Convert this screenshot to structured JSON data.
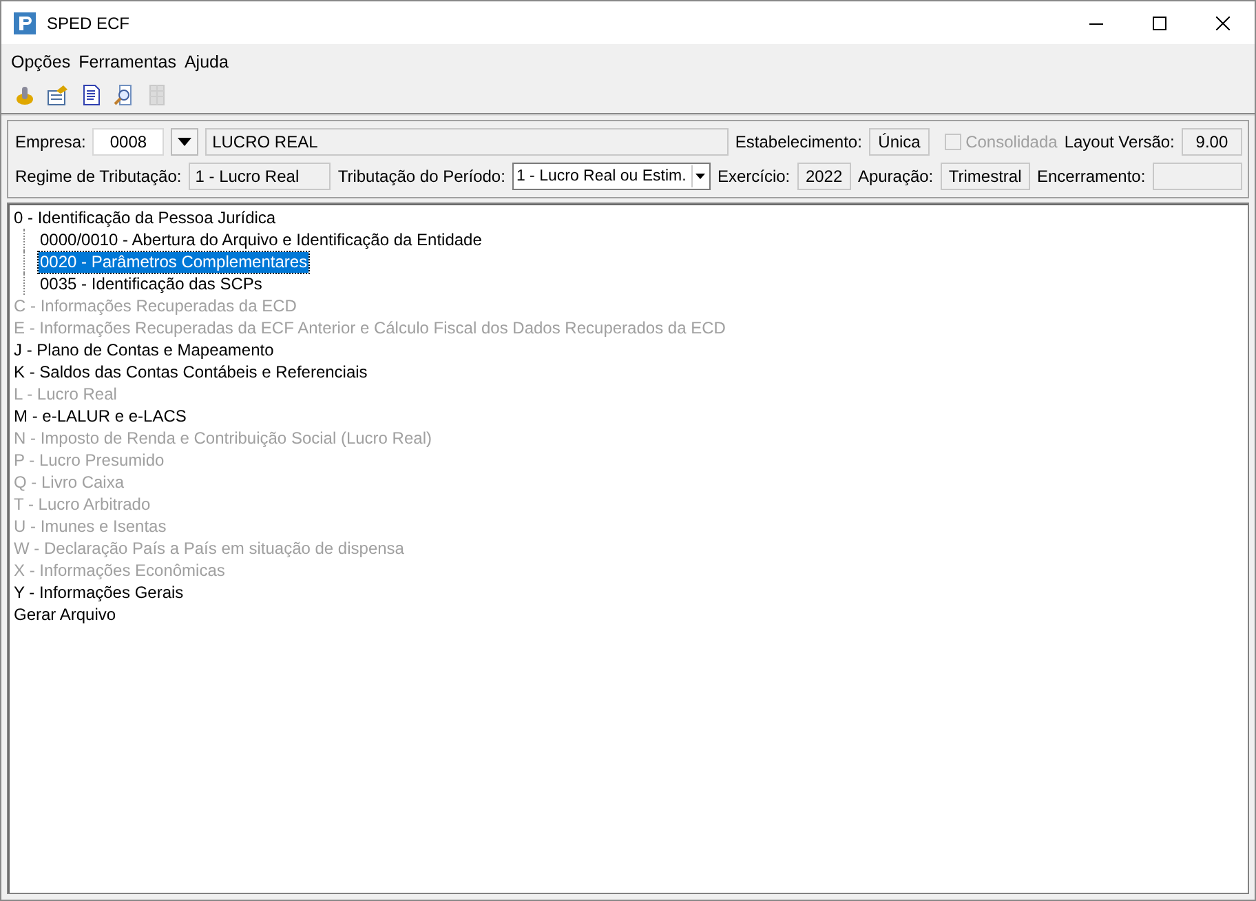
{
  "window": {
    "title": "SPED ECF"
  },
  "menu": [
    {
      "label": "Opções"
    },
    {
      "label": "Ferramentas"
    },
    {
      "label": "Ajuda"
    }
  ],
  "toolbar": [
    {
      "kind": "wizard",
      "disabled": false
    },
    {
      "kind": "open",
      "disabled": false
    },
    {
      "kind": "document",
      "disabled": false
    },
    {
      "kind": "preview",
      "disabled": false
    },
    {
      "kind": "grid",
      "disabled": true
    }
  ],
  "header": {
    "row_1": [
      {
        "kind": "label",
        "text": "Empresa:"
      },
      {
        "kind": "input",
        "value": "0008"
      },
      {
        "kind": "dropbutton"
      },
      {
        "kind": "readonly",
        "value": "LUCRO REAL"
      },
      {
        "kind": "label",
        "text": "Estabelecimento:"
      },
      {
        "kind": "readonly",
        "value": "Única"
      },
      {
        "kind": "checkbox",
        "text": "Consolidada",
        "checked": false,
        "disabled": true
      },
      {
        "kind": "label",
        "text": "Layout Versão:"
      },
      {
        "kind": "readonly",
        "value": "9.00"
      }
    ],
    "row_2": [
      {
        "kind": "label",
        "text": "Regime de Tributação:"
      },
      {
        "kind": "readonly",
        "value": "1 - Lucro Real"
      },
      {
        "kind": "label",
        "text": "Tributação do Período:"
      },
      {
        "kind": "combo",
        "value": "1 - Lucro Real ou Estim."
      },
      {
        "kind": "label",
        "text": "Exercício:"
      },
      {
        "kind": "readonly",
        "value": "2022"
      },
      {
        "kind": "label",
        "text": "Apuração:"
      },
      {
        "kind": "readonly",
        "value": "Trimestral"
      },
      {
        "kind": "label",
        "text": "Encerramento:"
      },
      {
        "kind": "readonly"
      }
    ]
  },
  "tree": [
    {
      "label": "0 - Identificação da Pessoa Jurídica",
      "disabled": false,
      "selected": false,
      "children": [
        {
          "label": "0000/0010 - Abertura do Arquivo e Identificação da Entidade",
          "disabled": false,
          "selected": false
        },
        {
          "label": "0020 - Parâmetros Complementares",
          "disabled": false,
          "selected": true
        },
        {
          "label": "0035 - Identificação das SCPs",
          "disabled": false,
          "selected": false
        }
      ]
    },
    {
      "label": "C - Informações Recuperadas da ECD",
      "disabled": true,
      "selected": false
    },
    {
      "label": "E - Informações Recuperadas da ECF Anterior e Cálculo Fiscal dos Dados Recuperados da ECD",
      "disabled": true,
      "selected": false
    },
    {
      "label": "J - Plano de Contas e Mapeamento",
      "disabled": false,
      "selected": false
    },
    {
      "label": "K - Saldos das Contas Contábeis e Referenciais",
      "disabled": false,
      "selected": false
    },
    {
      "label": "L - Lucro Real",
      "disabled": true,
      "selected": false
    },
    {
      "label": "M - e-LALUR e e-LACS",
      "disabled": false,
      "selected": false
    },
    {
      "label": "N - Imposto de Renda e Contribuição Social (Lucro Real)",
      "disabled": true,
      "selected": false
    },
    {
      "label": "P - Lucro Presumido",
      "disabled": true,
      "selected": false
    },
    {
      "label": "Q - Livro Caixa",
      "disabled": true,
      "selected": false
    },
    {
      "label": "T - Lucro Arbitrado",
      "disabled": true,
      "selected": false
    },
    {
      "label": "U - Imunes e Isentas",
      "disabled": true,
      "selected": false
    },
    {
      "label": "W - Declaração País a País em situação de dispensa",
      "disabled": true,
      "selected": false
    },
    {
      "label": "X - Informações Econômicas",
      "disabled": true,
      "selected": false
    },
    {
      "label": "Y - Informações Gerais",
      "disabled": false,
      "selected": false
    },
    {
      "label": "Gerar Arquivo",
      "disabled": false,
      "selected": false
    }
  ]
}
